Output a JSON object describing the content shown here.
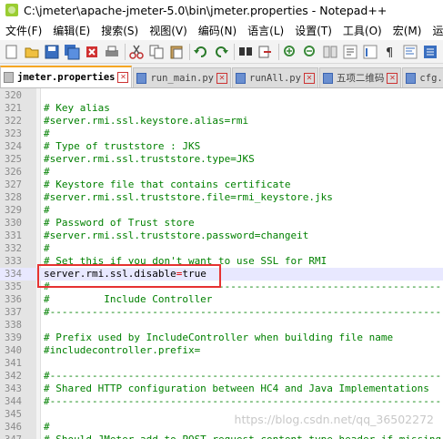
{
  "window": {
    "title": "C:\\jmeter\\apache-jmeter-5.0\\bin\\jmeter.properties - Notepad++"
  },
  "menu": [
    "文件(F)",
    "编辑(E)",
    "搜索(S)",
    "视图(V)",
    "编码(N)",
    "语言(L)",
    "设置(T)",
    "工具(O)",
    "宏(M)",
    "运"
  ],
  "tabs": [
    {
      "label": "jmeter.properties",
      "active": true
    },
    {
      "label": "run_main.py",
      "active": false
    },
    {
      "label": "runAll.py",
      "active": false
    },
    {
      "label": "五项二维码",
      "active": false
    },
    {
      "label": "cfg.",
      "active": false
    }
  ],
  "editor": {
    "lines": [
      {
        "num": "320",
        "text": "",
        "type": "blank"
      },
      {
        "num": "321",
        "text": "# Key alias",
        "type": "comment"
      },
      {
        "num": "322",
        "text": "#server.rmi.ssl.keystore.alias=rmi",
        "type": "comment"
      },
      {
        "num": "323",
        "text": "#",
        "type": "comment"
      },
      {
        "num": "324",
        "text": "# Type of truststore : JKS",
        "type": "comment"
      },
      {
        "num": "325",
        "text": "#server.rmi.ssl.truststore.type=JKS",
        "type": "comment"
      },
      {
        "num": "326",
        "text": "#",
        "type": "comment"
      },
      {
        "num": "327",
        "text": "# Keystore file that contains certificate",
        "type": "comment"
      },
      {
        "num": "328",
        "text": "#server.rmi.ssl.truststore.file=rmi_keystore.jks",
        "type": "comment"
      },
      {
        "num": "329",
        "text": "#",
        "type": "comment"
      },
      {
        "num": "330",
        "text": "# Password of Trust store",
        "type": "comment"
      },
      {
        "num": "331",
        "text": "#server.rmi.ssl.truststore.password=changeit",
        "type": "comment"
      },
      {
        "num": "332",
        "text": "#",
        "type": "comment"
      },
      {
        "num": "333",
        "text": "# Set this if you don't want to use SSL for RMI",
        "type": "comment"
      },
      {
        "num": "334",
        "key": "server.rmi.ssl.disable",
        "eq": "=",
        "value": "true",
        "type": "property"
      },
      {
        "num": "335",
        "text": "#---------------------------------------------------------------------------",
        "type": "comment"
      },
      {
        "num": "336",
        "text": "#         Include Controller",
        "type": "comment"
      },
      {
        "num": "337",
        "text": "#---------------------------------------------------------------------------",
        "type": "comment"
      },
      {
        "num": "338",
        "text": "",
        "type": "blank"
      },
      {
        "num": "339",
        "text": "# Prefix used by IncludeController when building file name",
        "type": "comment"
      },
      {
        "num": "340",
        "text": "#includecontroller.prefix=",
        "type": "comment"
      },
      {
        "num": "341",
        "text": "",
        "type": "blank"
      },
      {
        "num": "342",
        "text": "#---------------------------------------------------------------------------",
        "type": "comment"
      },
      {
        "num": "343",
        "text": "# Shared HTTP configuration between HC4 and Java Implementations",
        "type": "comment"
      },
      {
        "num": "344",
        "text": "#---------------------------------------------------------------------------",
        "type": "comment"
      },
      {
        "num": "345",
        "text": "",
        "type": "blank"
      },
      {
        "num": "346",
        "text": "#",
        "type": "comment"
      },
      {
        "num": "347",
        "text": "# Should JMeter add to POST request content-type header if missing:",
        "type": "comment"
      }
    ]
  },
  "watermark": "https://blog.csdn.net/qq_36502272"
}
